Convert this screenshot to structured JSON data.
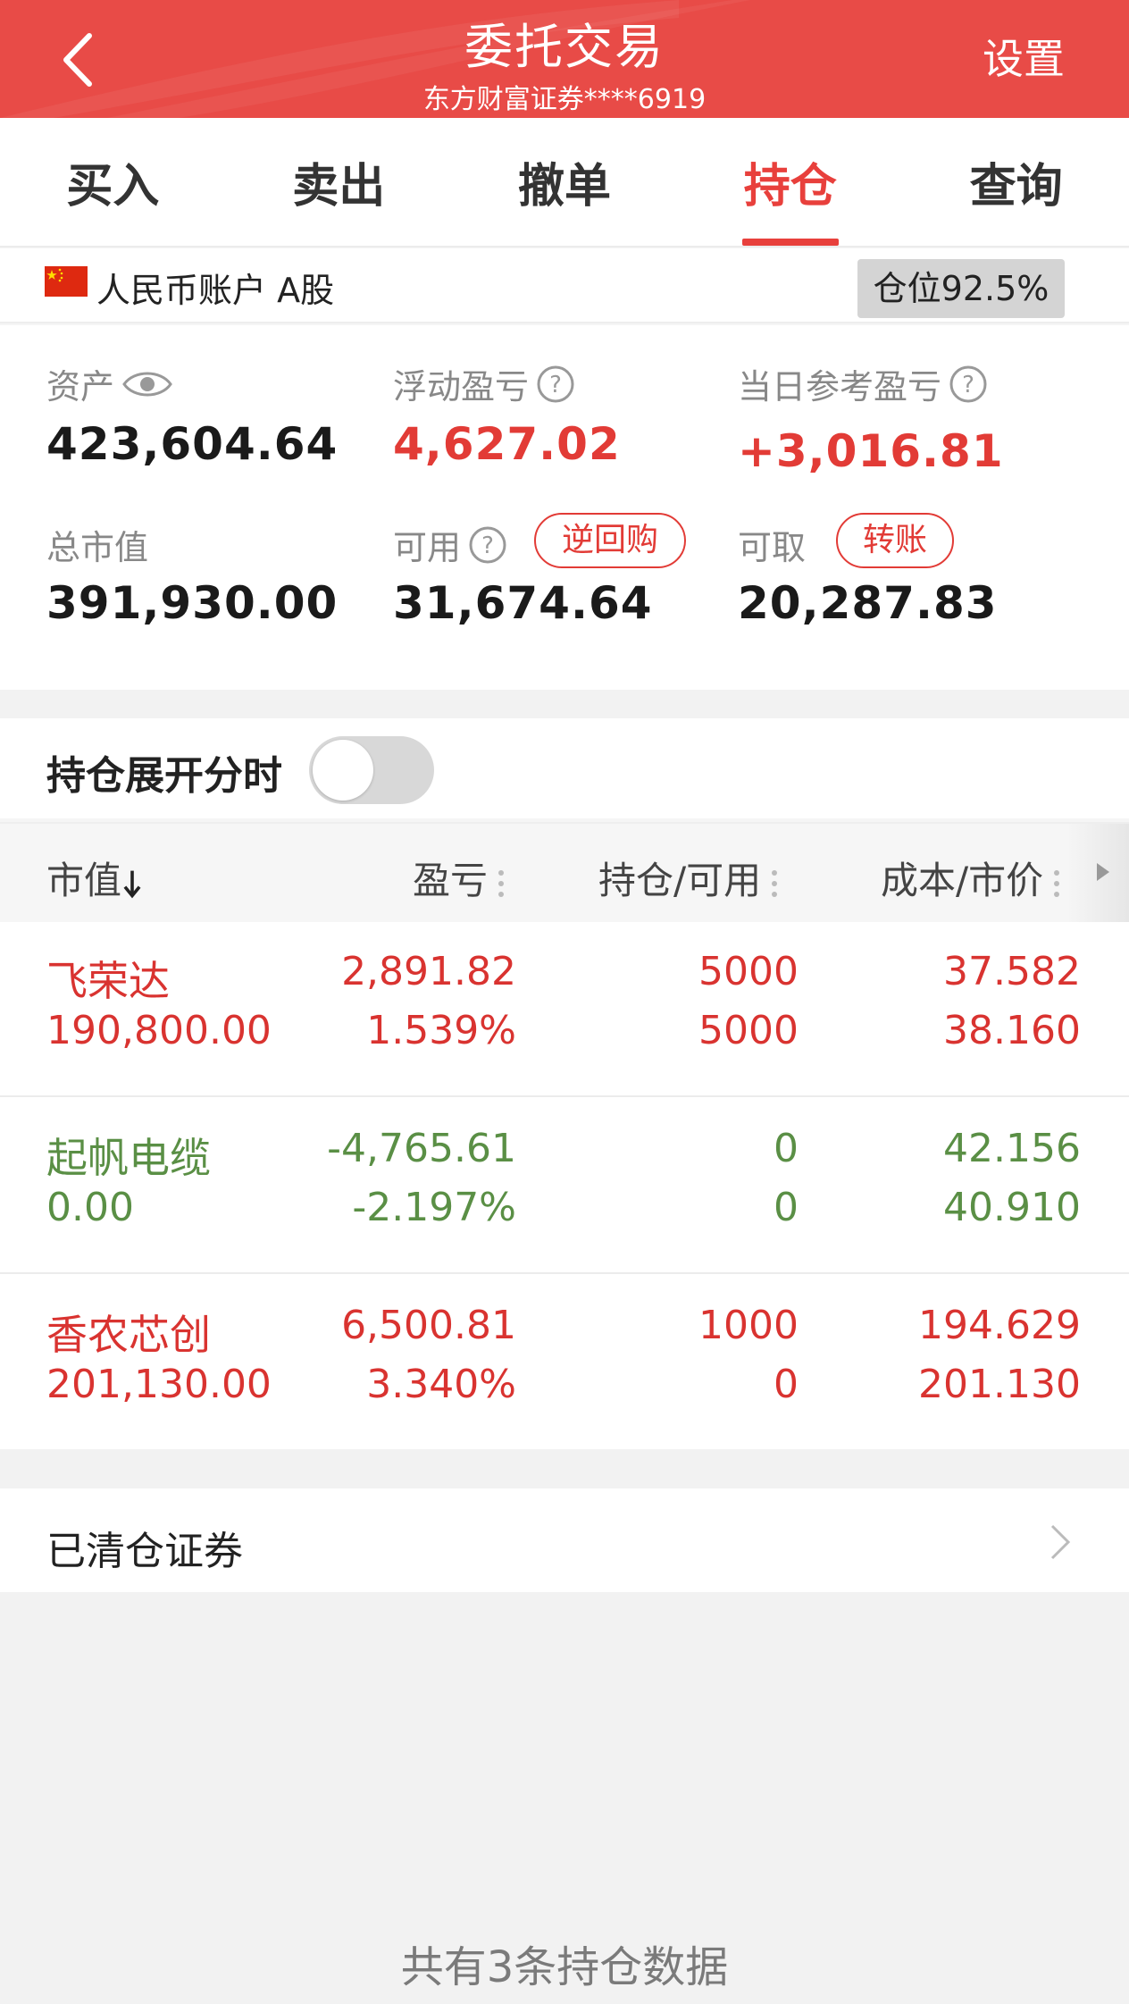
{
  "header": {
    "title": "委托交易",
    "subtitle": "东方财富证券****6919",
    "settings_label": "设置",
    "background_color": "#e84b47"
  },
  "tabs": [
    {
      "label": "买入",
      "active": false
    },
    {
      "label": "卖出",
      "active": false
    },
    {
      "label": "撤单",
      "active": false
    },
    {
      "label": "持仓",
      "active": true
    },
    {
      "label": "查询",
      "active": false
    }
  ],
  "account": {
    "label": "人民币账户 A股",
    "position_ratio": "仓位92.5%",
    "flag_icon": "china-flag-icon"
  },
  "summary": {
    "assets_label": "资产",
    "assets_value": "423,604.64",
    "floating_pl_label": "浮动盈亏",
    "floating_pl_value": "4,627.02",
    "daily_pl_label": "当日参考盈亏",
    "daily_pl_value": "+3,016.81",
    "market_value_label": "总市值",
    "market_value": "391,930.00",
    "available_label": "可用",
    "available_value": "31,674.64",
    "reverse_repo_label": "逆回购",
    "withdrawable_label": "可取",
    "withdrawable_value": "20,287.83",
    "transfer_label": "转账"
  },
  "expand": {
    "label": "持仓展开分时",
    "enabled": false
  },
  "table": {
    "headers": [
      "市值",
      "盈亏",
      "持仓/可用",
      "成本/市价"
    ],
    "rows": [
      {
        "name": "飞荣达",
        "market_value": "190,800.00",
        "pl": "2,891.82",
        "pl_pct": "1.539%",
        "holding": "5000",
        "available": "5000",
        "cost": "37.582",
        "price": "38.160",
        "trend": "up"
      },
      {
        "name": "起帆电缆",
        "market_value": "0.00",
        "pl": "-4,765.61",
        "pl_pct": "-2.197%",
        "holding": "0",
        "available": "0",
        "cost": "42.156",
        "price": "40.910",
        "trend": "down"
      },
      {
        "name": "香农芯创",
        "market_value": "201,130.00",
        "pl": "6,500.81",
        "pl_pct": "3.340%",
        "holding": "1000",
        "available": "0",
        "cost": "194.629",
        "price": "201.130",
        "trend": "up"
      }
    ]
  },
  "cleared": {
    "label": "已清仓证券"
  },
  "footer": {
    "text": "共有3条持仓数据"
  },
  "colors": {
    "accent": "#e8403c",
    "up": "#d93330",
    "down": "#5a8f45"
  }
}
